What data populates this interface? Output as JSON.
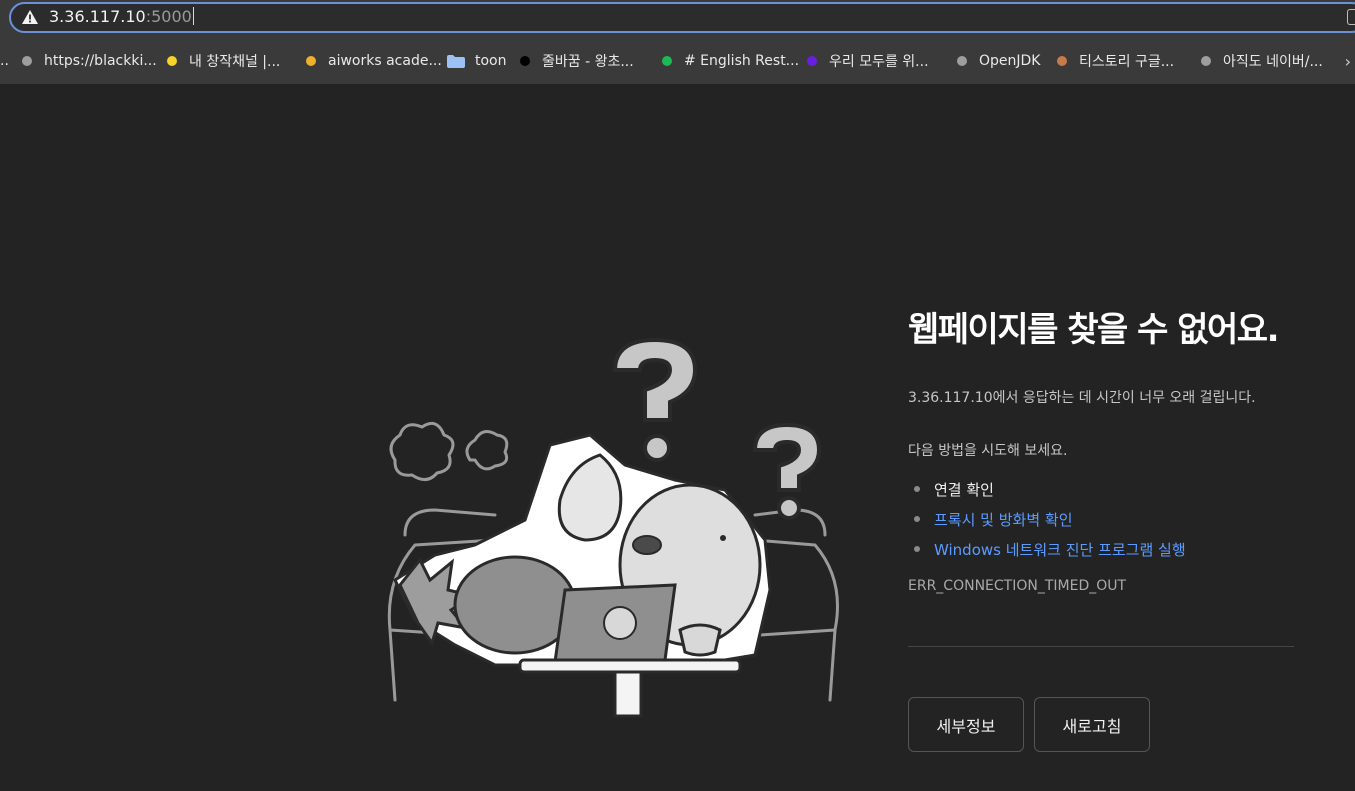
{
  "address_bar": {
    "host": "3.36.117.10",
    "port": ":5000"
  },
  "bookmarks": [
    {
      "label": "https://blackki...",
      "icon": "gray-dot-icon",
      "color": "#9e9e9e"
    },
    {
      "label": "내 창작채널 |...",
      "icon": "yellow-dot-icon",
      "color": "#f5d22c"
    },
    {
      "label": "aiworks acade...",
      "icon": "orange-dot-icon",
      "color": "#f0b02a"
    },
    {
      "label": "toon",
      "icon": "folder-icon",
      "color": "#9cc2f5"
    },
    {
      "label": "줄바꿈 - 왕초...",
      "icon": "black-dot-icon",
      "color": "#000000"
    },
    {
      "label": "# English Rest...",
      "icon": "green-dot-icon",
      "color": "#1db954"
    },
    {
      "label": "우리 모두를 위...",
      "icon": "purple-dot-icon",
      "color": "#6a1fe0"
    },
    {
      "label": "OpenJDK",
      "icon": "gray-dot-icon",
      "color": "#9e9e9e"
    },
    {
      "label": "티스토리 구글...",
      "icon": "brown-dot-icon",
      "color": "#c77a4a"
    },
    {
      "label": "아직도 네이버/...",
      "icon": "gray-dot-icon",
      "color": "#9e9e9e"
    }
  ],
  "error": {
    "title": "웹페이지를 찾을 수 없어요.",
    "message": "3.36.117.10에서 응답하는 데 시간이 너무 오래 걸립니다.",
    "try_label": "다음 방법을 시도해 보세요.",
    "suggestions": [
      {
        "label": "연결 확인",
        "link": false
      },
      {
        "label": "프록시 및 방화벽 확인",
        "link": true
      },
      {
        "label": "Windows 네트워크 진단 프로그램 실행",
        "link": true
      }
    ],
    "code": "ERR_CONNECTION_TIMED_OUT"
  },
  "buttons": {
    "details": "세부정보",
    "reload": "새로고침"
  },
  "colors": {
    "link": "#5b9bff",
    "focus_ring": "#6c8fd6",
    "background": "#232323"
  }
}
